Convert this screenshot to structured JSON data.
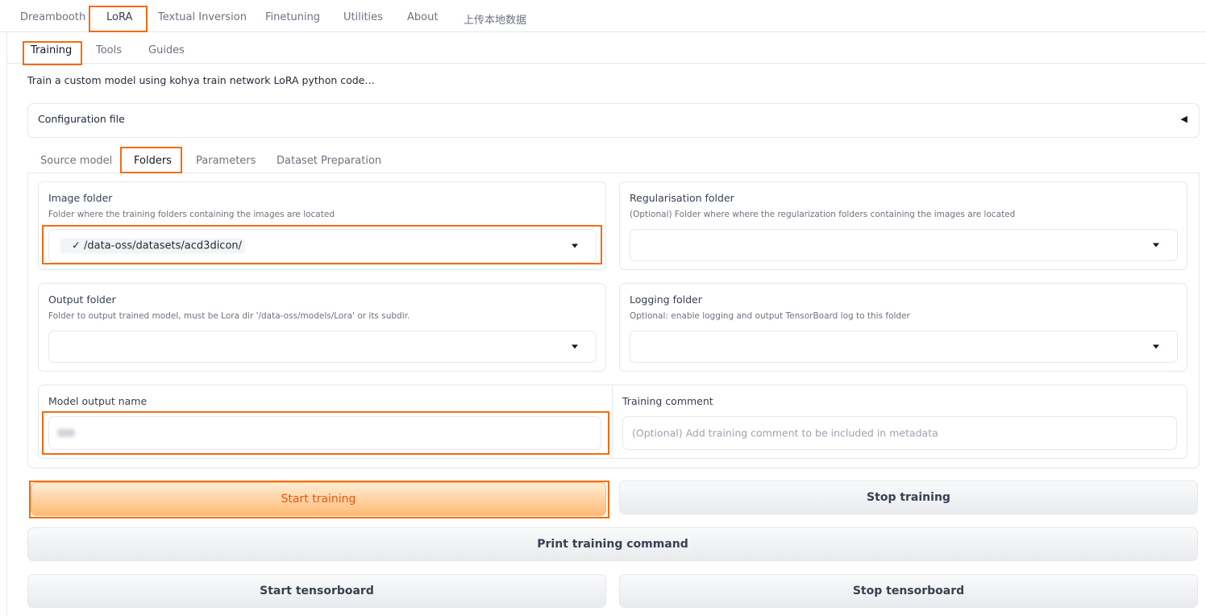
{
  "top_tabs": [
    "Dreambooth",
    "LoRA",
    "Textual Inversion",
    "Finetuning",
    "Utilities",
    "About",
    "上传本地数据"
  ],
  "sub_tabs": [
    "Training",
    "Tools",
    "Guides"
  ],
  "description": "Train a custom model using kohya train network LoRA python code…",
  "config_accordion": {
    "label": "Configuration file",
    "arrow": "◀"
  },
  "folder_tabs": [
    "Source model",
    "Folders",
    "Parameters",
    "Dataset Preparation"
  ],
  "image_folder": {
    "title": "Image folder",
    "info": "Folder where the training folders containing the images are located",
    "value": "✓ /data-oss/datasets/acd3dicon/"
  },
  "reg_folder": {
    "title": "Regularisation folder",
    "info": "(Optional) Folder where where the regularization folders containing the images are located",
    "value": ""
  },
  "output_folder": {
    "title": "Output folder",
    "info": "Folder to output trained model, must be Lora dir '/data-oss/models/Lora' or its subdir.",
    "value": ""
  },
  "logging_folder": {
    "title": "Logging folder",
    "info": "Optional: enable logging and output TensorBoard log to this folder",
    "value": ""
  },
  "model_output_name": {
    "title": "Model output name"
  },
  "training_comment": {
    "title": "Training comment",
    "placeholder": "(Optional) Add training comment to be included in metadata"
  },
  "buttons": {
    "start_training": "Start training",
    "stop_training": "Stop training",
    "print_command": "Print training command",
    "start_tensorboard": "Start tensorboard",
    "stop_tensorboard": "Stop tensorboard"
  },
  "colors": {
    "highlight": "#f26d0f",
    "primary_text": "#ea580c"
  }
}
